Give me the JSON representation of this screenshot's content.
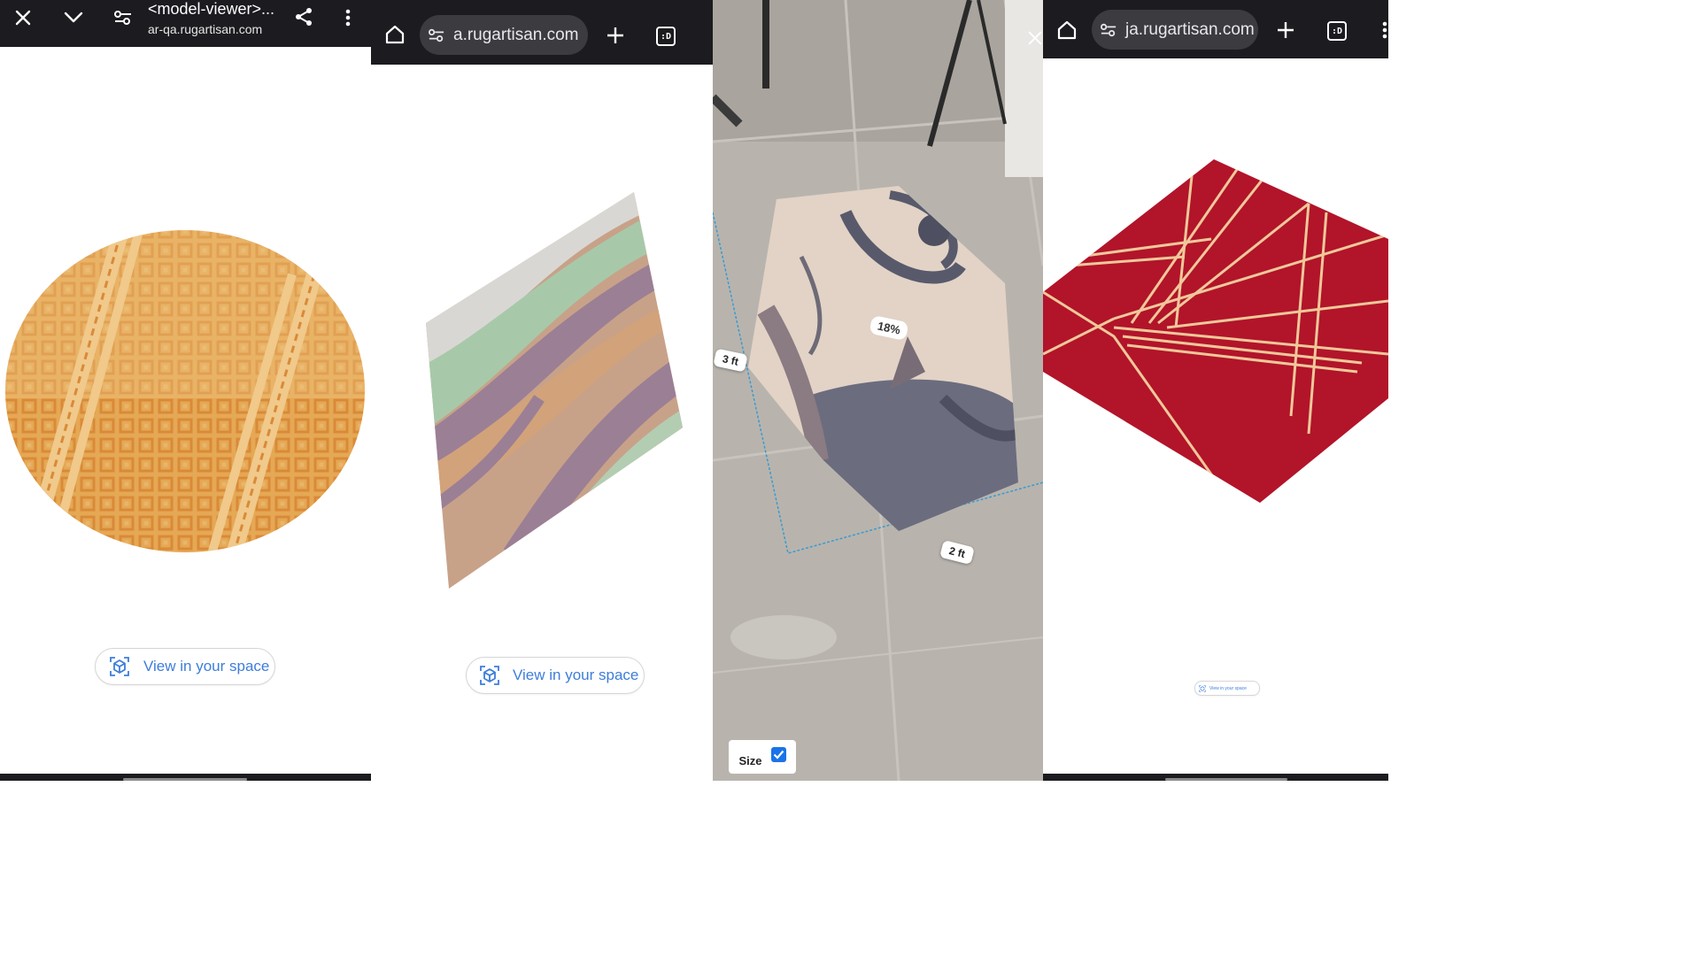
{
  "panel1": {
    "toolbar": {
      "close_icon": "close-icon",
      "minimize_icon": "chevron-down-icon",
      "page_title": "<model-viewer>...",
      "url": "ar-qa.rugartisan.com",
      "share_icon": "share-icon",
      "menu_icon": "more-vert-icon"
    },
    "ar_button": {
      "label": "View in your space",
      "icon": "ar-cube-icon"
    }
  },
  "panel2": {
    "toolbar": {
      "home_icon": "home-icon",
      "url": "a.rugartisan.com",
      "new_tab_icon": "plus-icon",
      "tab_count": ":D"
    },
    "ar_button": {
      "label": "View in your space",
      "icon": "ar-cube-icon"
    }
  },
  "panel3": {
    "close_icon": "close-icon",
    "measure": {
      "width_label": "3 ft",
      "depth_label": "2 ft",
      "scale_label": "18%"
    },
    "size_toggle": {
      "label": "Size",
      "checked": true
    }
  },
  "panel4": {
    "toolbar": {
      "home_icon": "home-icon",
      "url": "ja.rugartisan.com",
      "new_tab_icon": "plus-icon",
      "tab_count": ":D"
    },
    "ar_button": {
      "label": "View in your space",
      "icon": "ar-cube-icon"
    }
  },
  "colors": {
    "toolbar_bg": "#1c1b1f",
    "omnibox_bg": "#3b3b40",
    "link_blue": "#3e7ddb",
    "checkbox_blue": "#1a73e8",
    "rug_orange": "#e0a24c",
    "rug_red": "#b2142a",
    "floor_gray": "#b9b6b0"
  }
}
